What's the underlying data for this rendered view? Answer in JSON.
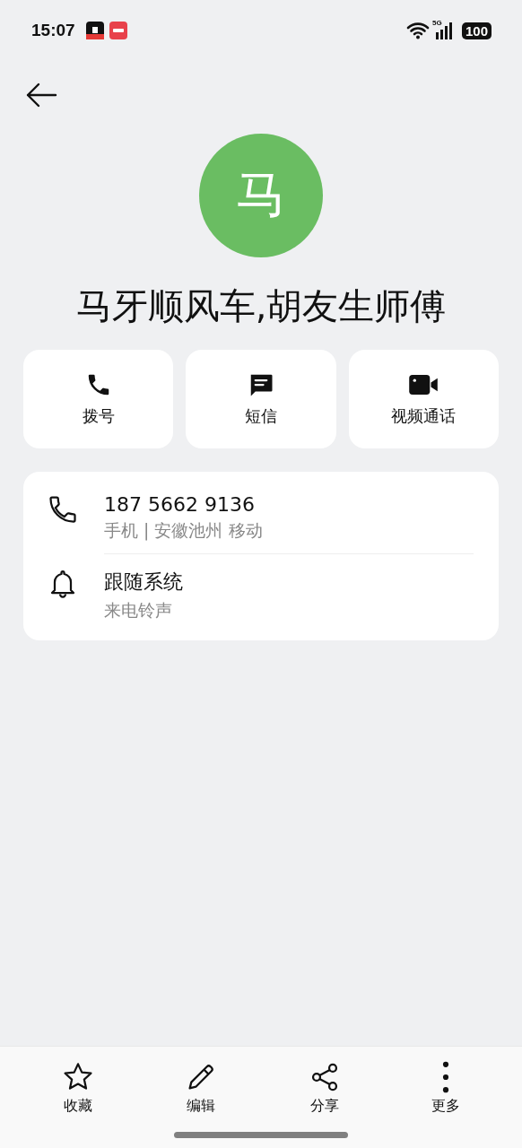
{
  "status_bar": {
    "time": "15:07",
    "network": "5G",
    "battery": "100"
  },
  "contact": {
    "avatar_letter": "马",
    "name": "马牙顺风车,胡友生师傅"
  },
  "actions": [
    {
      "kind": "call",
      "label": "拨号"
    },
    {
      "kind": "message",
      "label": "短信"
    },
    {
      "kind": "video",
      "label": "视频通话"
    }
  ],
  "details": [
    {
      "kind": "phone",
      "title": "187 5662 9136",
      "subtitle": "手机 | 安徽池州 移动"
    },
    {
      "kind": "ringtone",
      "title": "跟随系统",
      "subtitle": "来电铃声"
    }
  ],
  "toolbar": [
    {
      "kind": "star",
      "label": "收藏"
    },
    {
      "kind": "edit",
      "label": "编辑"
    },
    {
      "kind": "share",
      "label": "分享"
    },
    {
      "kind": "more",
      "label": "更多"
    }
  ]
}
